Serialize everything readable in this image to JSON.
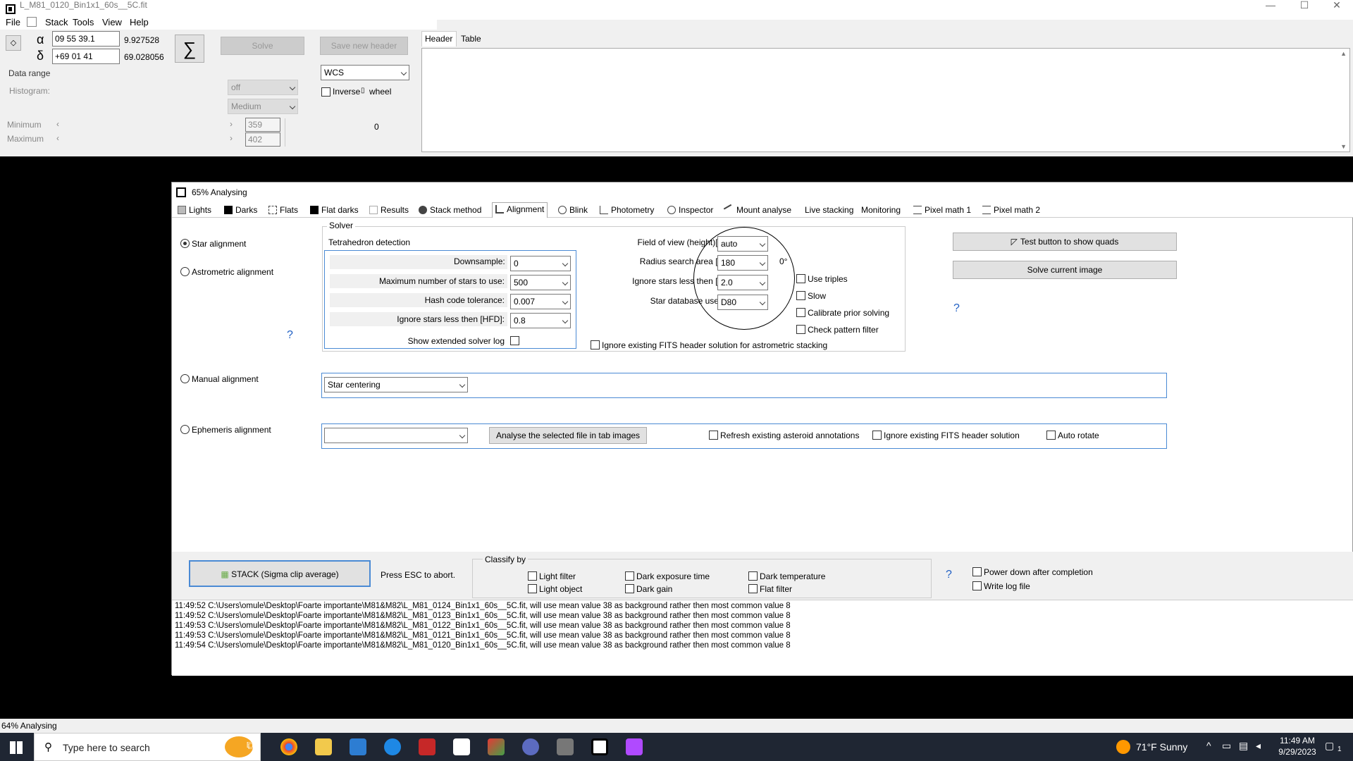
{
  "window": {
    "title": "L_M81_0120_Bin1x1_60s__5C.fit"
  },
  "menu": {
    "file": "File",
    "stack": "Stack",
    "tools": "Tools",
    "view": "View",
    "help": "Help"
  },
  "coords": {
    "alpha_sym": "α",
    "alpha_value": "09 55 39.1",
    "alpha_decimal": "9.927528",
    "delta_sym": "δ",
    "delta_value": "+69 01 41",
    "delta_decimal": "69.028056",
    "sigma": "∑",
    "solve": "Solve",
    "save_header": "Save new header"
  },
  "header_tabs": {
    "header": "Header",
    "table": "Table"
  },
  "wcs": {
    "value": "WCS",
    "inverse": "Inverse",
    "wheel": "wheel"
  },
  "data_range": {
    "title": "Data range",
    "histogram": "Histogram:",
    "histogram_value": "off",
    "quality": "Medium",
    "minimum": "Minimum",
    "maximum": "Maximum",
    "min_value": "359",
    "max_value": "402",
    "zero": "0"
  },
  "subwin": {
    "title": "65% Analysing"
  },
  "tabs": [
    "Lights",
    "Darks",
    "Flats",
    "Flat darks",
    "Results",
    "Stack method",
    "Alignment",
    "Blink",
    "Photometry",
    "Inspector",
    "Mount analyse",
    "Live stacking",
    "Monitoring",
    "Pixel math 1",
    "Pixel math 2"
  ],
  "alignment": {
    "star": "Star alignment",
    "astrometric": "Astrometric alignment",
    "manual": "Manual alignment",
    "ephemeris": "Ephemeris alignment",
    "help": "?"
  },
  "solver": {
    "title": "Solver",
    "tetra": "Tetrahedron detection",
    "downsample": "Downsample:",
    "downsample_value": "0",
    "max_stars": "Maximum number of stars to use:",
    "max_stars_value": "500",
    "hash": "Hash code tolerance:",
    "hash_value": "0.007",
    "ignore_hfd": "Ignore stars less then [HFD]:",
    "ignore_hfd_value": "0.8",
    "ext_log": "Show extended solver log",
    "fov": "Field of view (height)[°]:",
    "fov_value": "auto",
    "radius": "Radius search area [°]:",
    "radius_value": "180",
    "radius_unit": "0°",
    "ignore_mag": "Ignore stars less then [°]:",
    "ignore_mag_value": "2.0",
    "db": "Star database used:",
    "db_value": "D80",
    "use_triples": "Use triples",
    "slow": "Slow",
    "calibrate": "Calibrate prior solving",
    "check_pattern": "Check pattern filter",
    "ignore_fits": "Ignore existing FITS header solution for astrometric stacking"
  },
  "right_buttons": {
    "test_quads": "Test button to show quads",
    "solve_current": "Solve current image"
  },
  "manual": {
    "mode": "Star centering"
  },
  "ephemeris": {
    "analyse": "Analyse the selected file in tab images",
    "refresh": "Refresh existing asteroid annotations",
    "ignore_fits": "Ignore existing FITS header solution",
    "auto_rotate": "Auto rotate"
  },
  "bottom": {
    "stack": "STACK (Sigma clip average)",
    "esc": "Press ESC to abort.",
    "classify": "Classify by",
    "light_filter": "Light filter",
    "light_object": "Light object",
    "dark_exposure": "Dark exposure time",
    "dark_gain": "Dark gain",
    "dark_temp": "Dark temperature",
    "flat_filter": "Flat filter",
    "power_down": "Power down after completion",
    "write_log": "Write log file"
  },
  "log": [
    "11:49:52  C:\\Users\\omule\\Desktop\\Foarte importante\\M81&M82\\L_M81_0124_Bin1x1_60s__5C.fit, will use mean value 38 as background rather then most common value 8",
    "11:49:52  C:\\Users\\omule\\Desktop\\Foarte importante\\M81&M82\\L_M81_0123_Bin1x1_60s__5C.fit, will use mean value 38 as background rather then most common value 8",
    "11:49:53  C:\\Users\\omule\\Desktop\\Foarte importante\\M81&M82\\L_M81_0122_Bin1x1_60s__5C.fit, will use mean value 38 as background rather then most common value 8",
    "11:49:53  C:\\Users\\omule\\Desktop\\Foarte importante\\M81&M82\\L_M81_0121_Bin1x1_60s__5C.fit, will use mean value 38 as background rather then most common value 8",
    "11:49:54  C:\\Users\\omule\\Desktop\\Foarte importante\\M81&M82\\L_M81_0120_Bin1x1_60s__5C.fit, will use mean value 38 as background rather then most common value 8"
  ],
  "status": "64% Analysing",
  "taskbar": {
    "search": "Type here to search",
    "weather": "71°F  Sunny",
    "time": "11:49 AM",
    "date": "9/29/2023",
    "notif": "1"
  },
  "colors": {
    "accent": "#4a8ad4",
    "taskbar": "#1f2633",
    "help": "#1f5fc4"
  }
}
